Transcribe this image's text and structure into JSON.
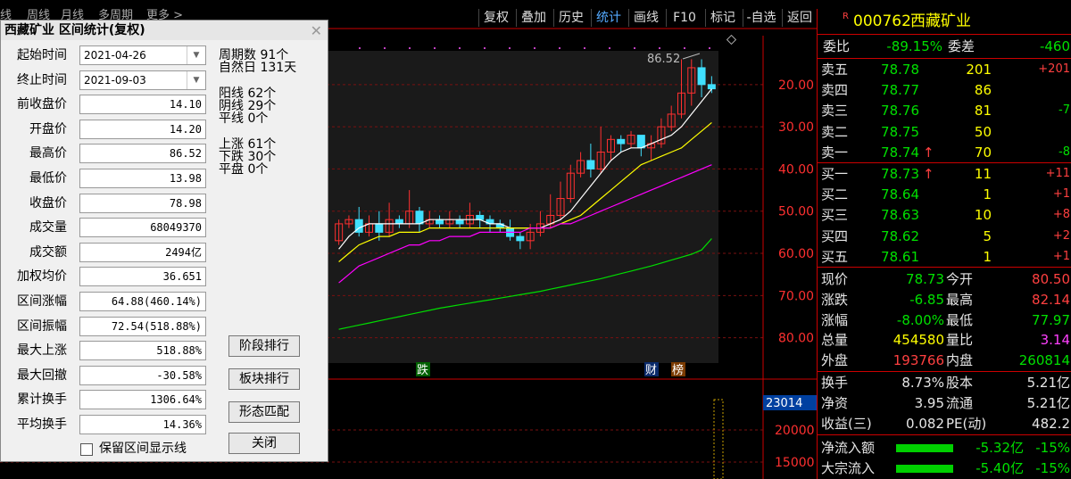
{
  "toolbar": {
    "tabs": [
      "线",
      "周线",
      "月线",
      "多周期",
      "更多 >"
    ],
    "buttons": [
      "复权",
      "叠加",
      "历史",
      "统计",
      "画线",
      "F10",
      "标记",
      "-自选",
      "返回"
    ],
    "active": "统计"
  },
  "chart": {
    "price_label": "86.52",
    "y_ticks": [
      "80.00",
      "70.00",
      "60.00",
      "50.00",
      "40.00",
      "30.00",
      "20.00"
    ],
    "vol_tag": "23014",
    "vol_ticks": [
      "20000",
      "15000"
    ],
    "markers": [
      "跌",
      "财",
      "榜"
    ]
  },
  "chart_data": {
    "type": "candlestick",
    "title": "",
    "ylim": [
      14,
      88
    ],
    "y_ticks": [
      20,
      30,
      40,
      50,
      60,
      70,
      80
    ],
    "candles": [
      [
        43,
        47,
        42,
        48
      ],
      [
        47,
        48,
        46,
        49
      ],
      [
        48,
        45,
        44,
        51
      ],
      [
        45,
        47,
        44,
        49
      ],
      [
        47,
        45,
        43,
        50
      ],
      [
        45,
        48,
        44,
        52
      ],
      [
        48,
        47,
        46,
        49
      ],
      [
        47,
        50,
        46,
        55
      ],
      [
        50,
        47,
        45,
        51
      ],
      [
        47,
        48,
        46,
        50
      ],
      [
        48,
        47,
        46,
        49
      ],
      [
        47,
        48,
        46,
        50
      ],
      [
        48,
        47,
        46,
        49
      ],
      [
        47,
        49,
        46,
        52
      ],
      [
        49,
        48,
        46,
        50
      ],
      [
        48,
        47,
        45,
        49
      ],
      [
        47,
        46,
        45,
        48
      ],
      [
        46,
        44,
        43,
        48
      ],
      [
        44,
        43,
        41,
        45
      ],
      [
        43,
        45,
        41,
        47
      ],
      [
        45,
        47,
        44,
        50
      ],
      [
        47,
        49,
        46,
        54
      ],
      [
        49,
        53,
        48,
        57
      ],
      [
        53,
        59,
        52,
        61
      ],
      [
        59,
        62,
        58,
        64
      ],
      [
        62,
        60,
        58,
        66
      ],
      [
        60,
        64,
        59,
        70
      ],
      [
        64,
        67,
        62,
        68
      ],
      [
        67,
        66,
        64,
        68
      ],
      [
        66,
        68,
        65,
        69
      ],
      [
        68,
        65,
        63,
        68
      ],
      [
        65,
        66,
        62,
        68
      ],
      [
        66,
        70,
        65,
        72
      ],
      [
        70,
        73,
        69,
        75
      ],
      [
        73,
        78,
        72,
        86
      ],
      [
        78,
        84,
        75,
        86
      ],
      [
        84,
        80,
        77,
        86
      ],
      [
        80,
        79,
        78,
        82
      ]
    ],
    "ma": [
      {
        "color": "#ffffff",
        "values": [
          41,
          44,
          46,
          47,
          47,
          47,
          47,
          47,
          47,
          48,
          48,
          48,
          48,
          48,
          48,
          47,
          47,
          46,
          46,
          46,
          46,
          47,
          48,
          50,
          53,
          56,
          59,
          62,
          64,
          65,
          65,
          66,
          67,
          68,
          70,
          73,
          76,
          79
        ]
      },
      {
        "color": "#ffff00",
        "values": [
          38,
          40,
          42,
          43,
          44,
          44,
          45,
          45,
          45,
          46,
          46,
          46,
          46,
          46,
          46,
          46,
          46,
          46,
          46,
          46,
          46,
          46,
          47,
          48,
          49,
          51,
          53,
          55,
          57,
          59,
          61,
          62,
          63,
          64,
          65,
          67,
          69,
          71
        ]
      },
      {
        "color": "#ff00ff",
        "values": [
          33,
          35,
          37,
          38,
          39,
          40,
          41,
          42,
          42,
          43,
          43,
          44,
          44,
          44,
          45,
          45,
          45,
          45,
          45,
          46,
          46,
          46,
          47,
          47,
          48,
          49,
          50,
          51,
          52,
          53,
          54,
          55,
          56,
          57,
          58,
          59,
          60,
          61
        ]
      },
      {
        "color": "#00dd00",
        "values": [
          22,
          22.5,
          23,
          23.5,
          24,
          24.5,
          25,
          25.5,
          26,
          26.5,
          27,
          27.4,
          27.8,
          28.2,
          28.6,
          29,
          29.4,
          29.8,
          30.2,
          30.6,
          31,
          31.5,
          32,
          32.5,
          33,
          33.5,
          34,
          34.6,
          35.2,
          35.8,
          36.4,
          37,
          37.7,
          38.4,
          39.1,
          39.8,
          40.8,
          43.5
        ]
      }
    ]
  },
  "dialog": {
    "title": "西藏矿业 区间统计(复权)",
    "fields": [
      {
        "label": "起始时间",
        "value": "2021-04-26"
      },
      {
        "label": "终止时间",
        "value": "2021-09-03"
      },
      {
        "label": "前收盘价",
        "value": "14.10"
      },
      {
        "label": "开盘价",
        "value": "14.20"
      },
      {
        "label": "最高价",
        "value": "86.52"
      },
      {
        "label": "最低价",
        "value": "13.98"
      },
      {
        "label": "收盘价",
        "value": "78.98"
      },
      {
        "label": "成交量",
        "value": "68049370"
      },
      {
        "label": "成交额",
        "value": "2494亿"
      },
      {
        "label": "加权均价",
        "value": "36.651"
      },
      {
        "label": "区间涨幅",
        "value": "64.88(460.14%)"
      },
      {
        "label": "区间振幅",
        "value": "72.54(518.88%)"
      },
      {
        "label": "最大上涨",
        "value": "518.88%"
      },
      {
        "label": "最大回撤",
        "value": "-30.58%"
      },
      {
        "label": "累计换手",
        "value": "1306.64%"
      },
      {
        "label": "平均换手",
        "value": "14.36%"
      }
    ],
    "stats": [
      "周期数 91个",
      "自然日 131天",
      "阳线 62个",
      "阴线 29个",
      "平线 0个",
      "上涨 61个",
      "下跌 30个",
      "平盘 0个"
    ],
    "buttons": [
      "阶段排行",
      "板块排行",
      "形态匹配",
      "关闭"
    ],
    "checkbox_label": "保留区间显示线"
  },
  "quote": {
    "r_badge": "R",
    "code": "000762",
    "name": "西藏矿业",
    "webi": {
      "label1": "委比",
      "v1": "-89.15%",
      "label2": "委差",
      "v2": "-460"
    },
    "asks": [
      {
        "label": "卖五",
        "price": "78.78",
        "vol": "201",
        "chg": "+201"
      },
      {
        "label": "卖四",
        "price": "78.77",
        "vol": "86",
        "chg": ""
      },
      {
        "label": "卖三",
        "price": "78.76",
        "vol": "81",
        "chg": "-7"
      },
      {
        "label": "卖二",
        "price": "78.75",
        "vol": "50",
        "chg": ""
      },
      {
        "label": "卖一",
        "price": "78.74",
        "vol": "70",
        "chg": "-8"
      }
    ],
    "bids": [
      {
        "label": "买一",
        "price": "78.73",
        "vol": "11",
        "chg": "+11"
      },
      {
        "label": "买二",
        "price": "78.64",
        "vol": "1",
        "chg": "+1"
      },
      {
        "label": "买三",
        "price": "78.63",
        "vol": "10",
        "chg": "+8"
      },
      {
        "label": "买四",
        "price": "78.62",
        "vol": "5",
        "chg": "+2"
      },
      {
        "label": "买五",
        "price": "78.61",
        "vol": "1",
        "chg": "+1"
      }
    ],
    "stats": [
      {
        "l1": "现价",
        "v1": "78.73",
        "l2": "今开",
        "v2": "80.50"
      },
      {
        "l1": "涨跌",
        "v1": "-6.85",
        "l2": "最高",
        "v2": "82.14"
      },
      {
        "l1": "涨幅",
        "v1": "-8.00%",
        "l2": "最低",
        "v2": "77.97"
      },
      {
        "l1": "总量",
        "v1": "454580",
        "l2": "量比",
        "v2": "3.14"
      },
      {
        "l1": "外盘",
        "v1": "193766",
        "l2": "内盘",
        "v2": "260814"
      }
    ],
    "stats2": [
      {
        "l1": "换手",
        "v1": "8.73%",
        "l2": "股本",
        "v2": "5.21亿"
      },
      {
        "l1": "净资",
        "v1": "3.95",
        "l2": "流通",
        "v2": "5.21亿"
      },
      {
        "l1": "收益(三)",
        "v1": "0.082",
        "l2": "PE(动)",
        "v2": "482.2"
      }
    ],
    "flows": [
      {
        "label": "净流入额",
        "value": "-5.32亿",
        "pct": "-15%"
      },
      {
        "label": "大宗流入",
        "value": "-5.40亿",
        "pct": "-15%"
      }
    ]
  }
}
